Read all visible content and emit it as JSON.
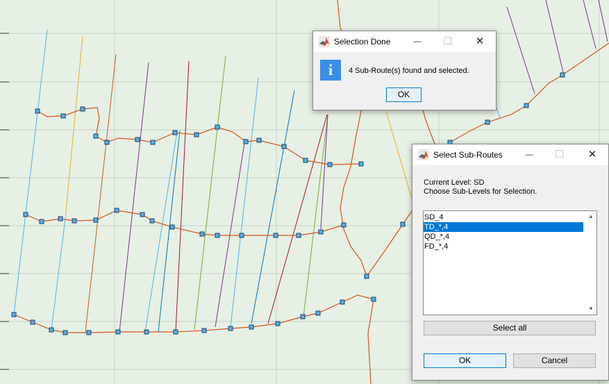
{
  "colors": {
    "map_bg": "#e6f0e4",
    "grid": "#c8d2c8",
    "route": "#d95319",
    "node_fill": "#4db3e6",
    "node_stroke": "#1f3f6e",
    "accent": "#0078d7"
  },
  "route_line_colors": [
    "#4db3e6",
    "#edb120",
    "#d95319",
    "#0072bd",
    "#7e2f8e",
    "#a2142f",
    "#77ac30"
  ],
  "selection_done": {
    "title": "Selection Done",
    "message": "4 Sub-Route(s) found and selected.",
    "ok_label": "OK",
    "icon": "info-icon",
    "minimize_glyph": "—",
    "maximize_glyph": "☐",
    "close_glyph": "✕"
  },
  "select_subroutes": {
    "title": "Select Sub-Routes",
    "current_level": "Current Level: SD",
    "instruction": "Choose Sub-Levels for Selection.",
    "list_items": [
      {
        "label": "SD_4",
        "selected": false
      },
      {
        "label": "TD_*,4",
        "selected": true
      },
      {
        "label": "QD_*,4",
        "selected": false
      },
      {
        "label": "FD_*,4",
        "selected": false
      }
    ],
    "select_all_label": "Select all",
    "ok_label": "OK",
    "cancel_label": "Cancel",
    "minimize_glyph": "—",
    "maximize_glyph": "☐",
    "close_glyph": "✕",
    "scroll_up_glyph": "▲",
    "scroll_down_glyph": "▼"
  }
}
